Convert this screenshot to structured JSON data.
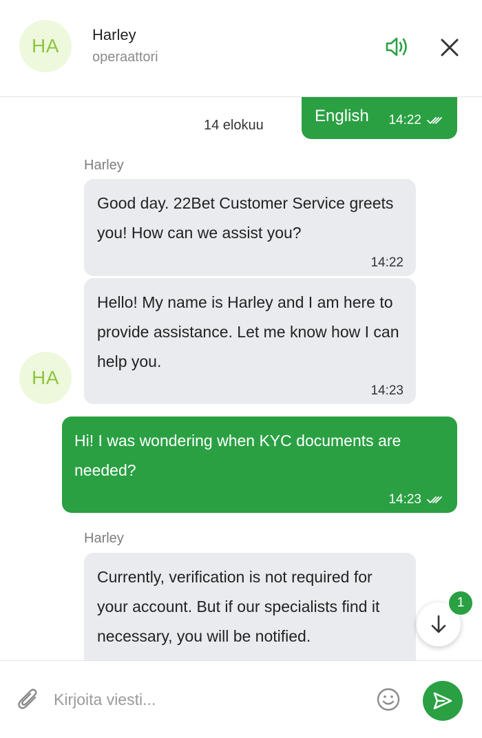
{
  "header": {
    "avatar_initials": "HA",
    "agent_name": "Harley",
    "agent_role": "operaattori"
  },
  "messages_area": {
    "date_label": "14 elokuu",
    "language_message": {
      "text": "English",
      "time": "14:22"
    },
    "items": [
      {
        "sender": "Harley",
        "text": "Good day. 22Bet Customer Service greets you! How can we assist you?",
        "time": "14:22"
      },
      {
        "text": "Hello! My name is Harley and I am here to provide assistance. Let me know how I can help you.",
        "time": "14:23"
      },
      {
        "text": "Hi! I was wondering when KYC documents are needed?",
        "time": "14:23"
      },
      {
        "sender": "Harley",
        "text": "Currently, verification is not required for your account. But if our specialists find it necessary, you will be notified.",
        "time": ""
      }
    ],
    "message_avatar_initials": "HA",
    "unread_count": "1"
  },
  "input": {
    "placeholder": "Kirjoita viesti..."
  },
  "colors": {
    "accent_green": "#2aa043",
    "incoming_bubble": "#e9ebee",
    "avatar_bg": "#eef8dc",
    "avatar_text": "#8cc63f"
  }
}
